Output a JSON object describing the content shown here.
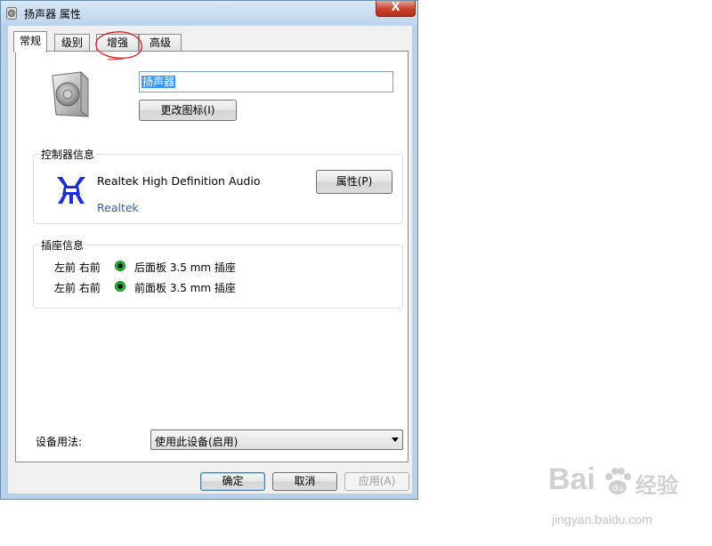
{
  "window": {
    "title": "扬声器 属性",
    "close_glyph": "X"
  },
  "tabs": [
    {
      "label": "常规",
      "active": true
    },
    {
      "label": "级别",
      "active": false
    },
    {
      "label": "增强",
      "active": false
    },
    {
      "label": "高级",
      "active": false
    }
  ],
  "device": {
    "name_value": "扬声器",
    "change_icon_label": "更改图标(I)",
    "icon": "speaker-icon"
  },
  "controller": {
    "group_label": "控制器信息",
    "device_name": "Realtek High Definition Audio",
    "vendor": "Realtek",
    "properties_label": "属性(P)",
    "icon": "realtek-logo-icon"
  },
  "jacks": {
    "group_label": "插座信息",
    "items": [
      {
        "channels": "左前 右前",
        "description": "后面板 3.5 mm 插座",
        "color": "#1fb62d"
      },
      {
        "channels": "左前 右前",
        "description": "前面板 3.5 mm 插座",
        "color": "#1fb62d"
      }
    ]
  },
  "usage": {
    "label": "设备用法:",
    "selected": "使用此设备(启用)"
  },
  "footer": {
    "ok_label": "确定",
    "cancel_label": "取消",
    "apply_label": "应用(A)"
  },
  "watermark": {
    "brand": "Bai",
    "brand_cn": "经验",
    "url": "jingyan.baidu.com"
  },
  "colors": {
    "annotation": "#e02020",
    "selection": "#3399ff",
    "link": "#3c5aa6"
  }
}
